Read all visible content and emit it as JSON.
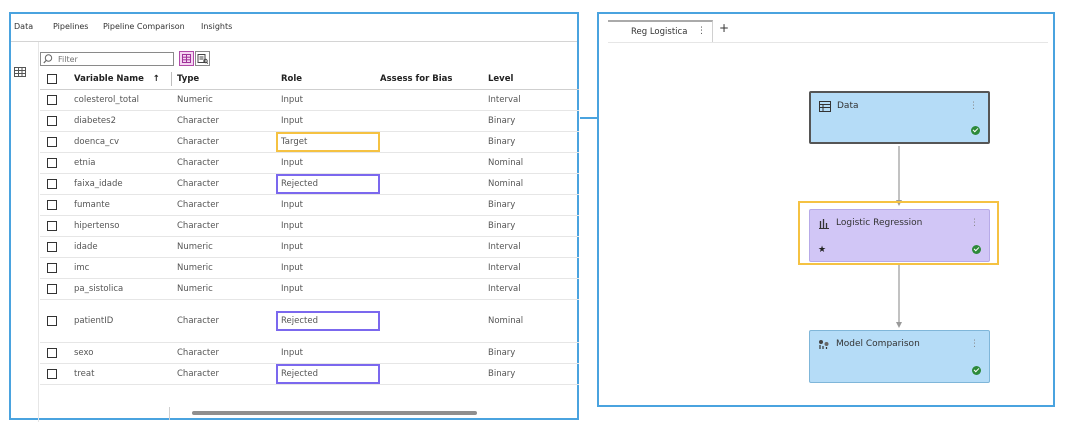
{
  "tabs": {
    "data": "Data",
    "pipelines": "Pipelines",
    "pipeline_comparison": "Pipeline Comparison",
    "insights": "Insights"
  },
  "filter": {
    "placeholder": "Filter"
  },
  "table": {
    "headers": {
      "name": "Variable Name",
      "sort_indicator": "↑",
      "type": "Type",
      "role": "Role",
      "bias": "Assess for Bias",
      "level": "Level"
    },
    "rows": [
      {
        "name": "colesterol_total",
        "type": "Numeric",
        "role": "Input",
        "level": "Interval"
      },
      {
        "name": "diabetes2",
        "type": "Character",
        "role": "Input",
        "level": "Binary"
      },
      {
        "name": "doenca_cv",
        "type": "Character",
        "role": "Target",
        "level": "Binary"
      },
      {
        "name": "etnia",
        "type": "Character",
        "role": "Input",
        "level": "Nominal"
      },
      {
        "name": "faixa_idade",
        "type": "Character",
        "role": "Rejected",
        "level": "Nominal"
      },
      {
        "name": "fumante",
        "type": "Character",
        "role": "Input",
        "level": "Binary"
      },
      {
        "name": "hipertenso",
        "type": "Character",
        "role": "Input",
        "level": "Binary"
      },
      {
        "name": "idade",
        "type": "Numeric",
        "role": "Input",
        "level": "Interval"
      },
      {
        "name": "imc",
        "type": "Numeric",
        "role": "Input",
        "level": "Interval"
      },
      {
        "name": "pa_sistolica",
        "type": "Numeric",
        "role": "Input",
        "level": "Interval"
      },
      {
        "name": "patientID",
        "type": "Character",
        "role": "Rejected",
        "level": "Nominal"
      },
      {
        "name": "sexo",
        "type": "Character",
        "role": "Input",
        "level": "Binary"
      },
      {
        "name": "treat",
        "type": "Character",
        "role": "Rejected",
        "level": "Binary"
      }
    ]
  },
  "pipeline": {
    "tab_label": "Reg Logistica",
    "tab_menu": "⋮",
    "add_tab": "+",
    "nodes": {
      "data": {
        "label": "Data",
        "menu": "⋮"
      },
      "logistic": {
        "label": "Logistic Regression",
        "menu": "⋮",
        "star": "★"
      },
      "model_comparison": {
        "label": "Model Comparison",
        "menu": "⋮"
      }
    }
  },
  "colors": {
    "panel_border": "#4aa3df",
    "node_blue": "#b5dcf7",
    "node_purple": "#d1c6f6",
    "target_highlight": "#f5c242",
    "rejected_highlight": "#7b68ee",
    "success_green": "#2d8a3a"
  }
}
